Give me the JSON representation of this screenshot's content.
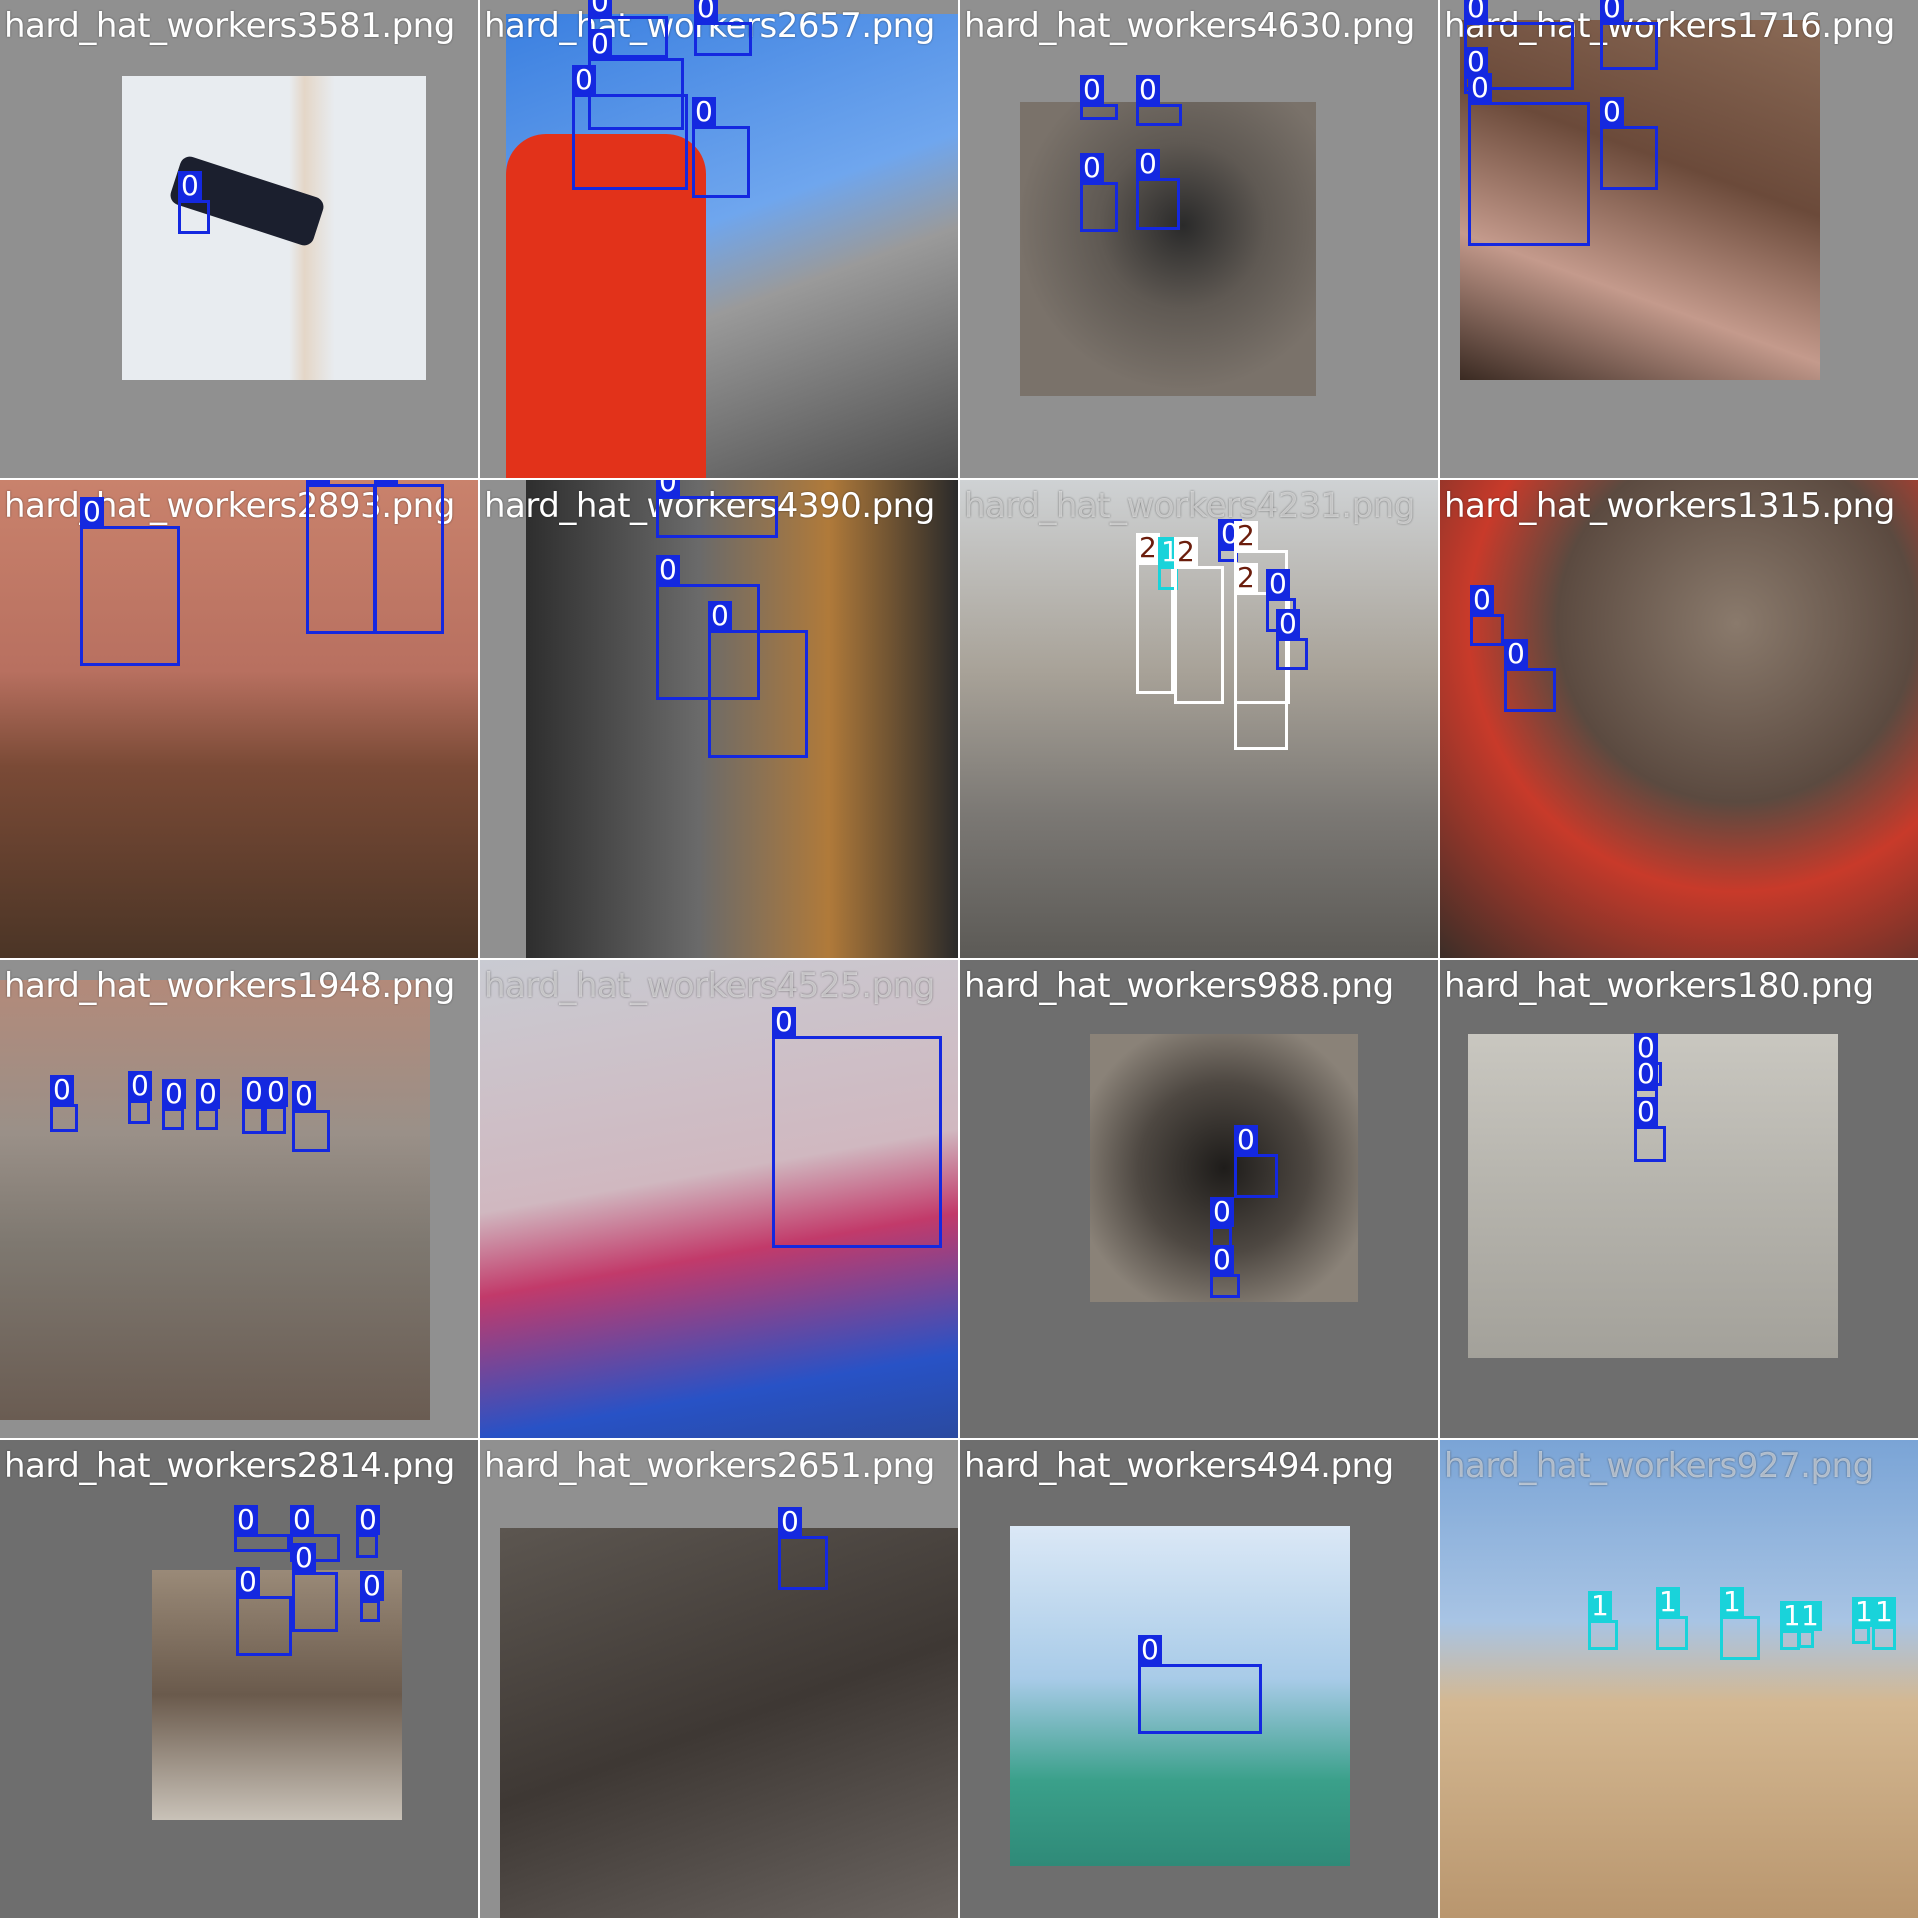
{
  "tiles": [
    {
      "filename": "hard_hat_workers3581.png",
      "labels": [
        "0"
      ]
    },
    {
      "filename": "hard_hat_workers2657.png",
      "labels": [
        "0",
        "0",
        "0",
        "0",
        "0"
      ]
    },
    {
      "filename": "hard_hat_workers4630.png",
      "labels": [
        "0",
        "0",
        "0",
        "0"
      ]
    },
    {
      "filename": "hard_hat_workers1716.png",
      "labels": [
        "0",
        "0",
        "0",
        "0",
        "0"
      ]
    },
    {
      "filename": "hard_hat_workers2893.png",
      "labels": [
        "0",
        "0",
        "0"
      ]
    },
    {
      "filename": "hard_hat_workers4390.png",
      "labels": [
        "0",
        "0",
        "0"
      ]
    },
    {
      "filename": "hard_hat_workers4231.png",
      "labels": [
        "2",
        "1",
        "2",
        "0",
        "2",
        "2",
        "0",
        "0"
      ]
    },
    {
      "filename": "hard_hat_workers1315.png",
      "labels": [
        "0",
        "0"
      ]
    },
    {
      "filename": "hard_hat_workers1948.png",
      "labels": [
        "0",
        "0",
        "0",
        "0",
        "0",
        "0",
        "0"
      ]
    },
    {
      "filename": "hard_hat_workers4525.png",
      "labels": [
        "0"
      ]
    },
    {
      "filename": "hard_hat_workers988.png",
      "labels": [
        "0",
        "0",
        "0"
      ]
    },
    {
      "filename": "hard_hat_workers180.png",
      "labels": [
        "0",
        "0",
        "0"
      ]
    },
    {
      "filename": "hard_hat_workers2814.png",
      "labels": [
        "0",
        "0",
        "0",
        "0",
        "0",
        "0"
      ]
    },
    {
      "filename": "hard_hat_workers2651.png",
      "labels": [
        "0"
      ]
    },
    {
      "filename": "hard_hat_workers494.png",
      "labels": [
        "0"
      ]
    },
    {
      "filename": "hard_hat_workers927.png",
      "labels": [
        "1",
        "1",
        "1",
        "1",
        "1",
        "1",
        "1"
      ]
    }
  ],
  "colors": {
    "class_0": "#1428e0",
    "class_1": "#19d3da",
    "class_2": "#ffffff"
  }
}
